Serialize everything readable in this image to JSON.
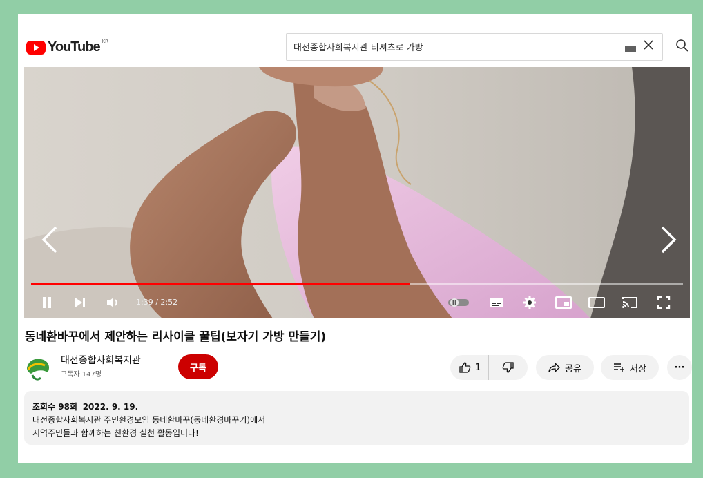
{
  "header": {
    "logo_text": "YouTube",
    "logo_region": "KR",
    "search_value": "대전종합사회복지관 티셔츠로 가방",
    "icons": [
      "youtube-logo-icon",
      "keyboard-icon",
      "clear-icon",
      "search-icon"
    ]
  },
  "player": {
    "time_display": "1:39 / 2:52",
    "progress_fraction": 0.58,
    "buffered_fraction": 1.0,
    "icons": [
      "prev-arrow-icon",
      "next-arrow-icon",
      "pause-icon",
      "next-icon",
      "volume-icon",
      "autoplay-toggle-icon",
      "subtitles-icon",
      "settings-icon",
      "miniplayer-icon",
      "theater-icon",
      "cast-icon",
      "fullscreen-icon"
    ],
    "accent_color": "#ff0000"
  },
  "video": {
    "title": "동네환바꾸에서 제안하는 리사이클 꿀팁(보자기 가방 만들기)"
  },
  "channel": {
    "name": "대전종합사회복지관",
    "subscribers": "구독자 147명",
    "subscribe_label": "구독"
  },
  "actions": {
    "like_count": "1",
    "share_label": "공유",
    "save_label": "저장",
    "more_label": "···"
  },
  "description": {
    "views": "조회수 98회",
    "date": "2022. 9. 19.",
    "line1": "대전종합사회복지관 주민환경모임 동네환바꾸(동네환경바꾸기)에서",
    "line2": "지역주민들과 함께하는 친환경 실천 활동입니다!"
  }
}
